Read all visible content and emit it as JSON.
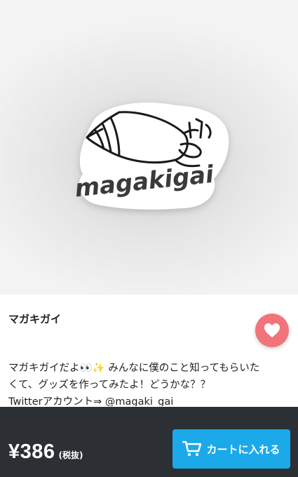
{
  "product": {
    "image_alt": "magakigai sticker",
    "image_word": "magakigai",
    "title": "マガキガイ",
    "description_lines": [
      "マガキガイだよ👀✨ みんなに僕のこと知ってもらいた",
      "くて、グッズを作ってみたよ！どうかな？？",
      "Twitterアカウント⇒ @magaki_gai"
    ]
  },
  "favorite": {
    "icon": "heart-icon",
    "color": "#f0757a"
  },
  "purchase": {
    "price": "¥386",
    "tax_note": "(税抜)",
    "cart_label": "カートに入れる",
    "cart_icon": "cart-icon",
    "button_color": "#1ba9ea",
    "bar_color": "#2c2f33"
  }
}
